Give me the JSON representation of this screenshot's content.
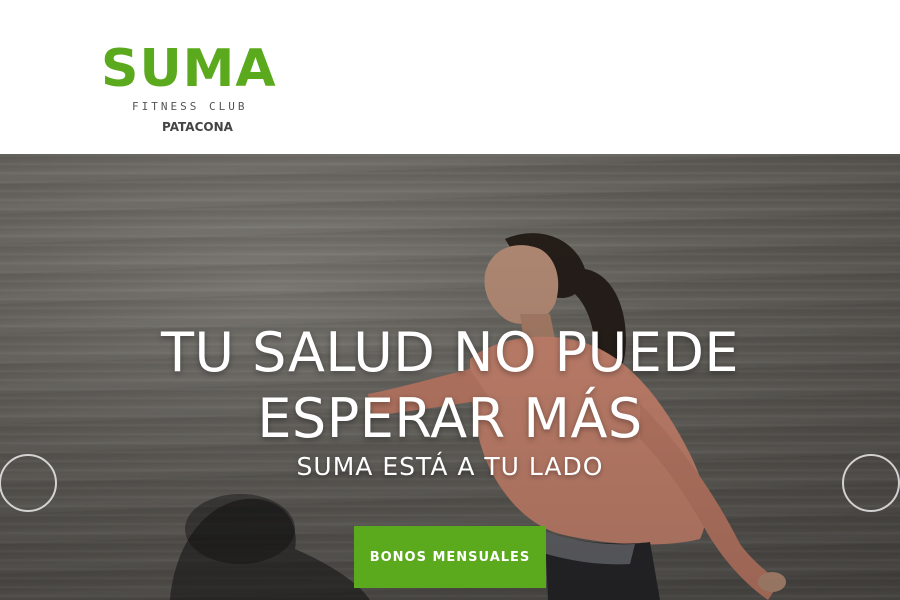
{
  "header": {
    "logo": {
      "brand": "SUMA",
      "tagline": "FITNESS CLUB",
      "location": "PATACONA",
      "brand_color": "#5ba91d"
    }
  },
  "hero": {
    "title_line1": "TU SALUD NO PUEDE",
    "title_line2": "ESPERAR MÁS",
    "subtitle": "SUMA ESTÁ A TU LADO",
    "cta_label": "BONOS MENSUALES",
    "cta_color": "#5ba91d",
    "prev_arrow_icon": "circle-left-arrow-icon",
    "next_arrow_icon": "circle-right-arrow-icon"
  }
}
